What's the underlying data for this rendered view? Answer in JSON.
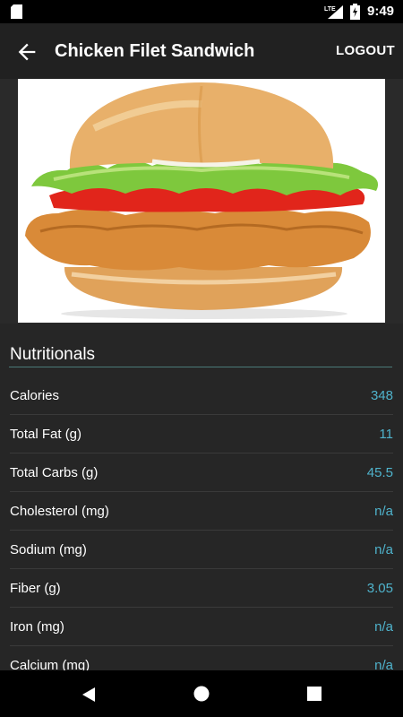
{
  "status_bar": {
    "network": "LTE",
    "time": "9:49",
    "icons": [
      "sd-card-icon",
      "lte-signal-icon",
      "battery-charging-icon"
    ]
  },
  "app_bar": {
    "title": "Chicken Filet Sandwich",
    "logout_label": "LOGOUT",
    "icons": [
      "back-arrow-icon"
    ]
  },
  "hero": {
    "image": "chicken-filet-sandwich-photo"
  },
  "nutritionals": {
    "heading": "Nutritionals",
    "rows": [
      {
        "label": "Calories",
        "value": "348"
      },
      {
        "label": "Total Fat (g)",
        "value": "11"
      },
      {
        "label": "Total Carbs (g)",
        "value": "45.5"
      },
      {
        "label": "Cholesterol (mg)",
        "value": "n/a"
      },
      {
        "label": "Sodium (mg)",
        "value": "n/a"
      },
      {
        "label": "Fiber (g)",
        "value": "3.05"
      },
      {
        "label": "Iron (mg)",
        "value": "n/a"
      },
      {
        "label": "Calcium (mg)",
        "value": "n/a"
      }
    ]
  },
  "nav_bar": {
    "icons": [
      "nav-back-icon",
      "nav-home-icon",
      "nav-recents-icon"
    ]
  },
  "colors": {
    "background": "#212121",
    "value_accent": "#4fb3cc",
    "divider_accent": "#4a7a78"
  }
}
